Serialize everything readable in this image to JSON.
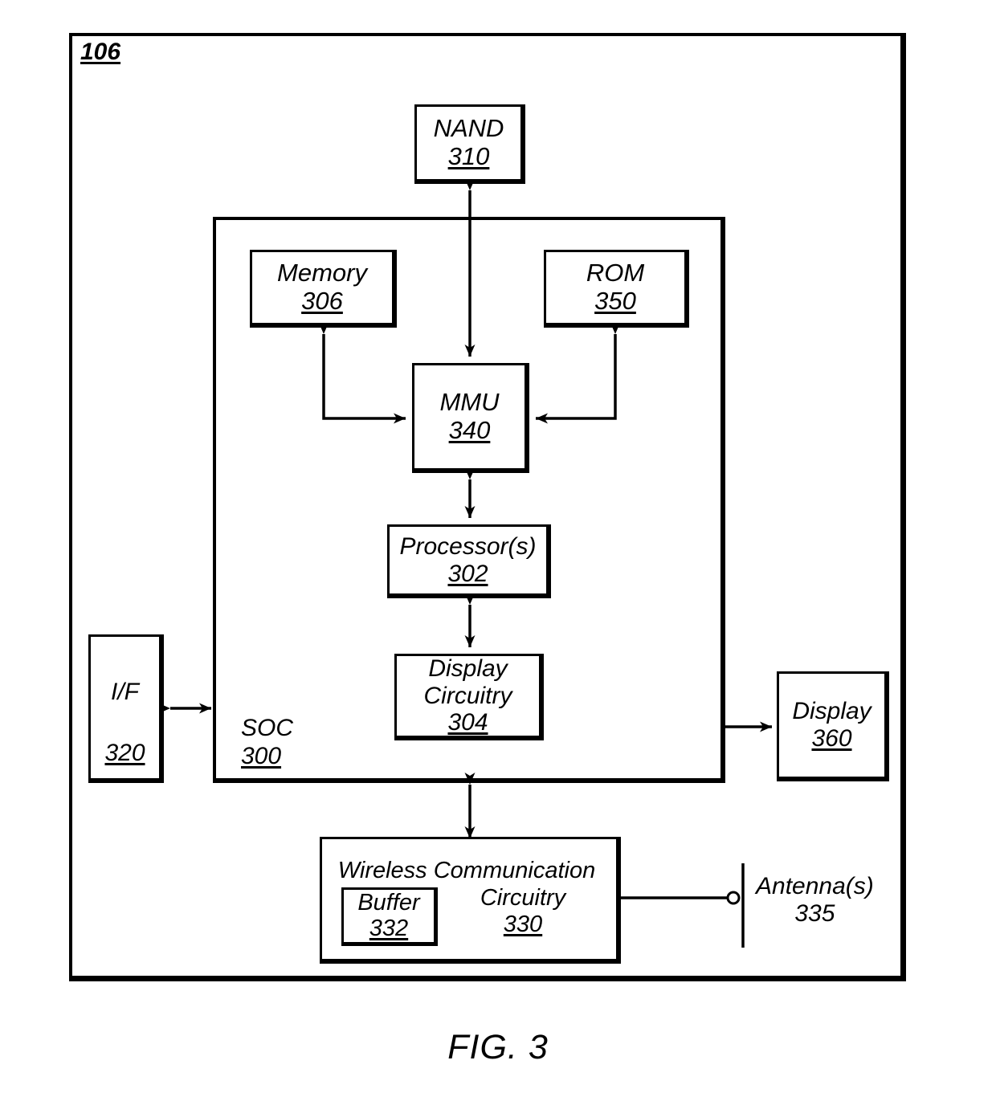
{
  "figure": {
    "caption": "FIG. 3",
    "frame_number": "106"
  },
  "blocks": {
    "nand": {
      "label": "NAND",
      "number": "310"
    },
    "memory": {
      "label": "Memory",
      "number": "306"
    },
    "rom": {
      "label": "ROM",
      "number": "350"
    },
    "mmu": {
      "label": "MMU",
      "number": "340"
    },
    "processor": {
      "label": "Processor(s)",
      "number": "302"
    },
    "display_circuitry": {
      "label_line1": "Display",
      "label_line2": "Circuitry",
      "number": "304"
    },
    "interface": {
      "label": "I/F",
      "number": "320"
    },
    "display": {
      "label": "Display",
      "number": "360"
    },
    "soc": {
      "label": "SOC",
      "number": "300"
    },
    "wireless": {
      "label_line1": "Wireless Communication",
      "label_line2": "Circuitry",
      "number": "330"
    },
    "buffer": {
      "label": "Buffer",
      "number": "332"
    },
    "antenna": {
      "label": "Antenna(s)",
      "number": "335"
    }
  },
  "connections": [
    {
      "name": "nand-mmu",
      "from": "NAND 310",
      "to": "MMU 340",
      "arrows": "both"
    },
    {
      "name": "memory-mmu",
      "from": "Memory 306",
      "to": "MMU 340",
      "arrows": "both"
    },
    {
      "name": "rom-mmu",
      "from": "ROM 350",
      "to": "MMU 340",
      "arrows": "both"
    },
    {
      "name": "mmu-processor",
      "from": "MMU 340",
      "to": "Processor(s) 302",
      "arrows": "both"
    },
    {
      "name": "processor-displaycircuitry",
      "from": "Processor(s) 302",
      "to": "Display Circuitry 304",
      "arrows": "both"
    },
    {
      "name": "if-soc",
      "from": "I/F 320",
      "to": "SOC 300",
      "arrows": "both"
    },
    {
      "name": "soc-display",
      "from": "SOC 300",
      "to": "Display 360",
      "arrows": "single"
    },
    {
      "name": "soc-wireless",
      "from": "SOC 300",
      "to": "Wireless Communication Circuitry 330",
      "arrows": "both"
    },
    {
      "name": "wireless-antenna",
      "from": "Wireless Communication Circuitry 330",
      "to": "Antenna(s) 335",
      "arrows": "none"
    }
  ],
  "style": {
    "ink": "#000000",
    "paper": "#ffffff"
  }
}
